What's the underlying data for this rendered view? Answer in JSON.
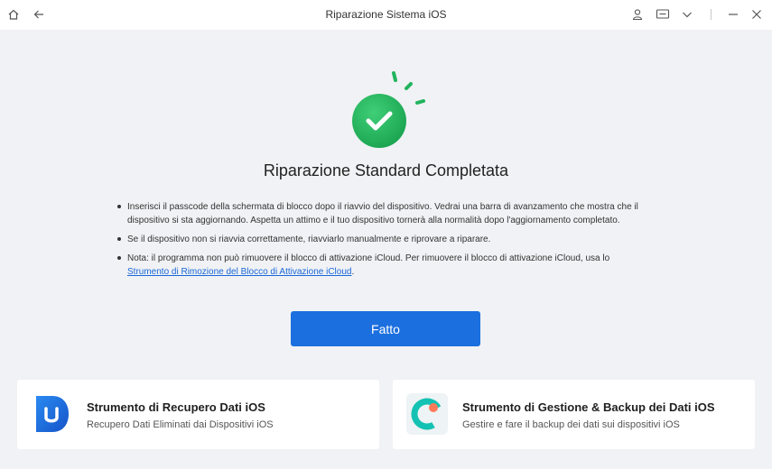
{
  "window": {
    "title": "Riparazione Sistema iOS",
    "icons": [
      "home-icon",
      "back-arrow-icon",
      "user-icon",
      "chat-icon",
      "chevron-down-icon",
      "minimize-icon",
      "close-icon"
    ]
  },
  "main": {
    "heading": "Riparazione Standard Completata",
    "notes": [
      "Inserisci il passcode della schermata di blocco dopo il riavvio del dispositivo. Vedrai una barra di avanzamento che mostra che il dispositivo si sta aggiornando. Aspetta un attimo e il tuo dispositivo tornerà alla normalità dopo l'aggiornamento completato.",
      "Se il dispositivo non si riavvia correttamente, riavviarlo manualmente e riprovare a riparare.",
      "Nota: il programma non può rimuovere il blocco di attivazione iCloud. Per rimuovere il blocco di attivazione iCloud, usa lo"
    ],
    "note_link": "Strumento di Rimozione del Blocco di Attivazione iCloud",
    "note_link_suffix": ".",
    "done_label": "Fatto"
  },
  "cards": [
    {
      "title": "Strumento di Recupero Dati iOS",
      "subtitle": "Recupero Dati Eliminati dai Dispositivi iOS"
    },
    {
      "title": "Strumento di Gestione & Backup dei Dati iOS",
      "subtitle": "Gestire e fare il backup dei dati sui dispositivi iOS"
    }
  ],
  "colors": {
    "accent": "#1c6fde",
    "success": "#22b45e",
    "background": "#f0f2f5"
  }
}
